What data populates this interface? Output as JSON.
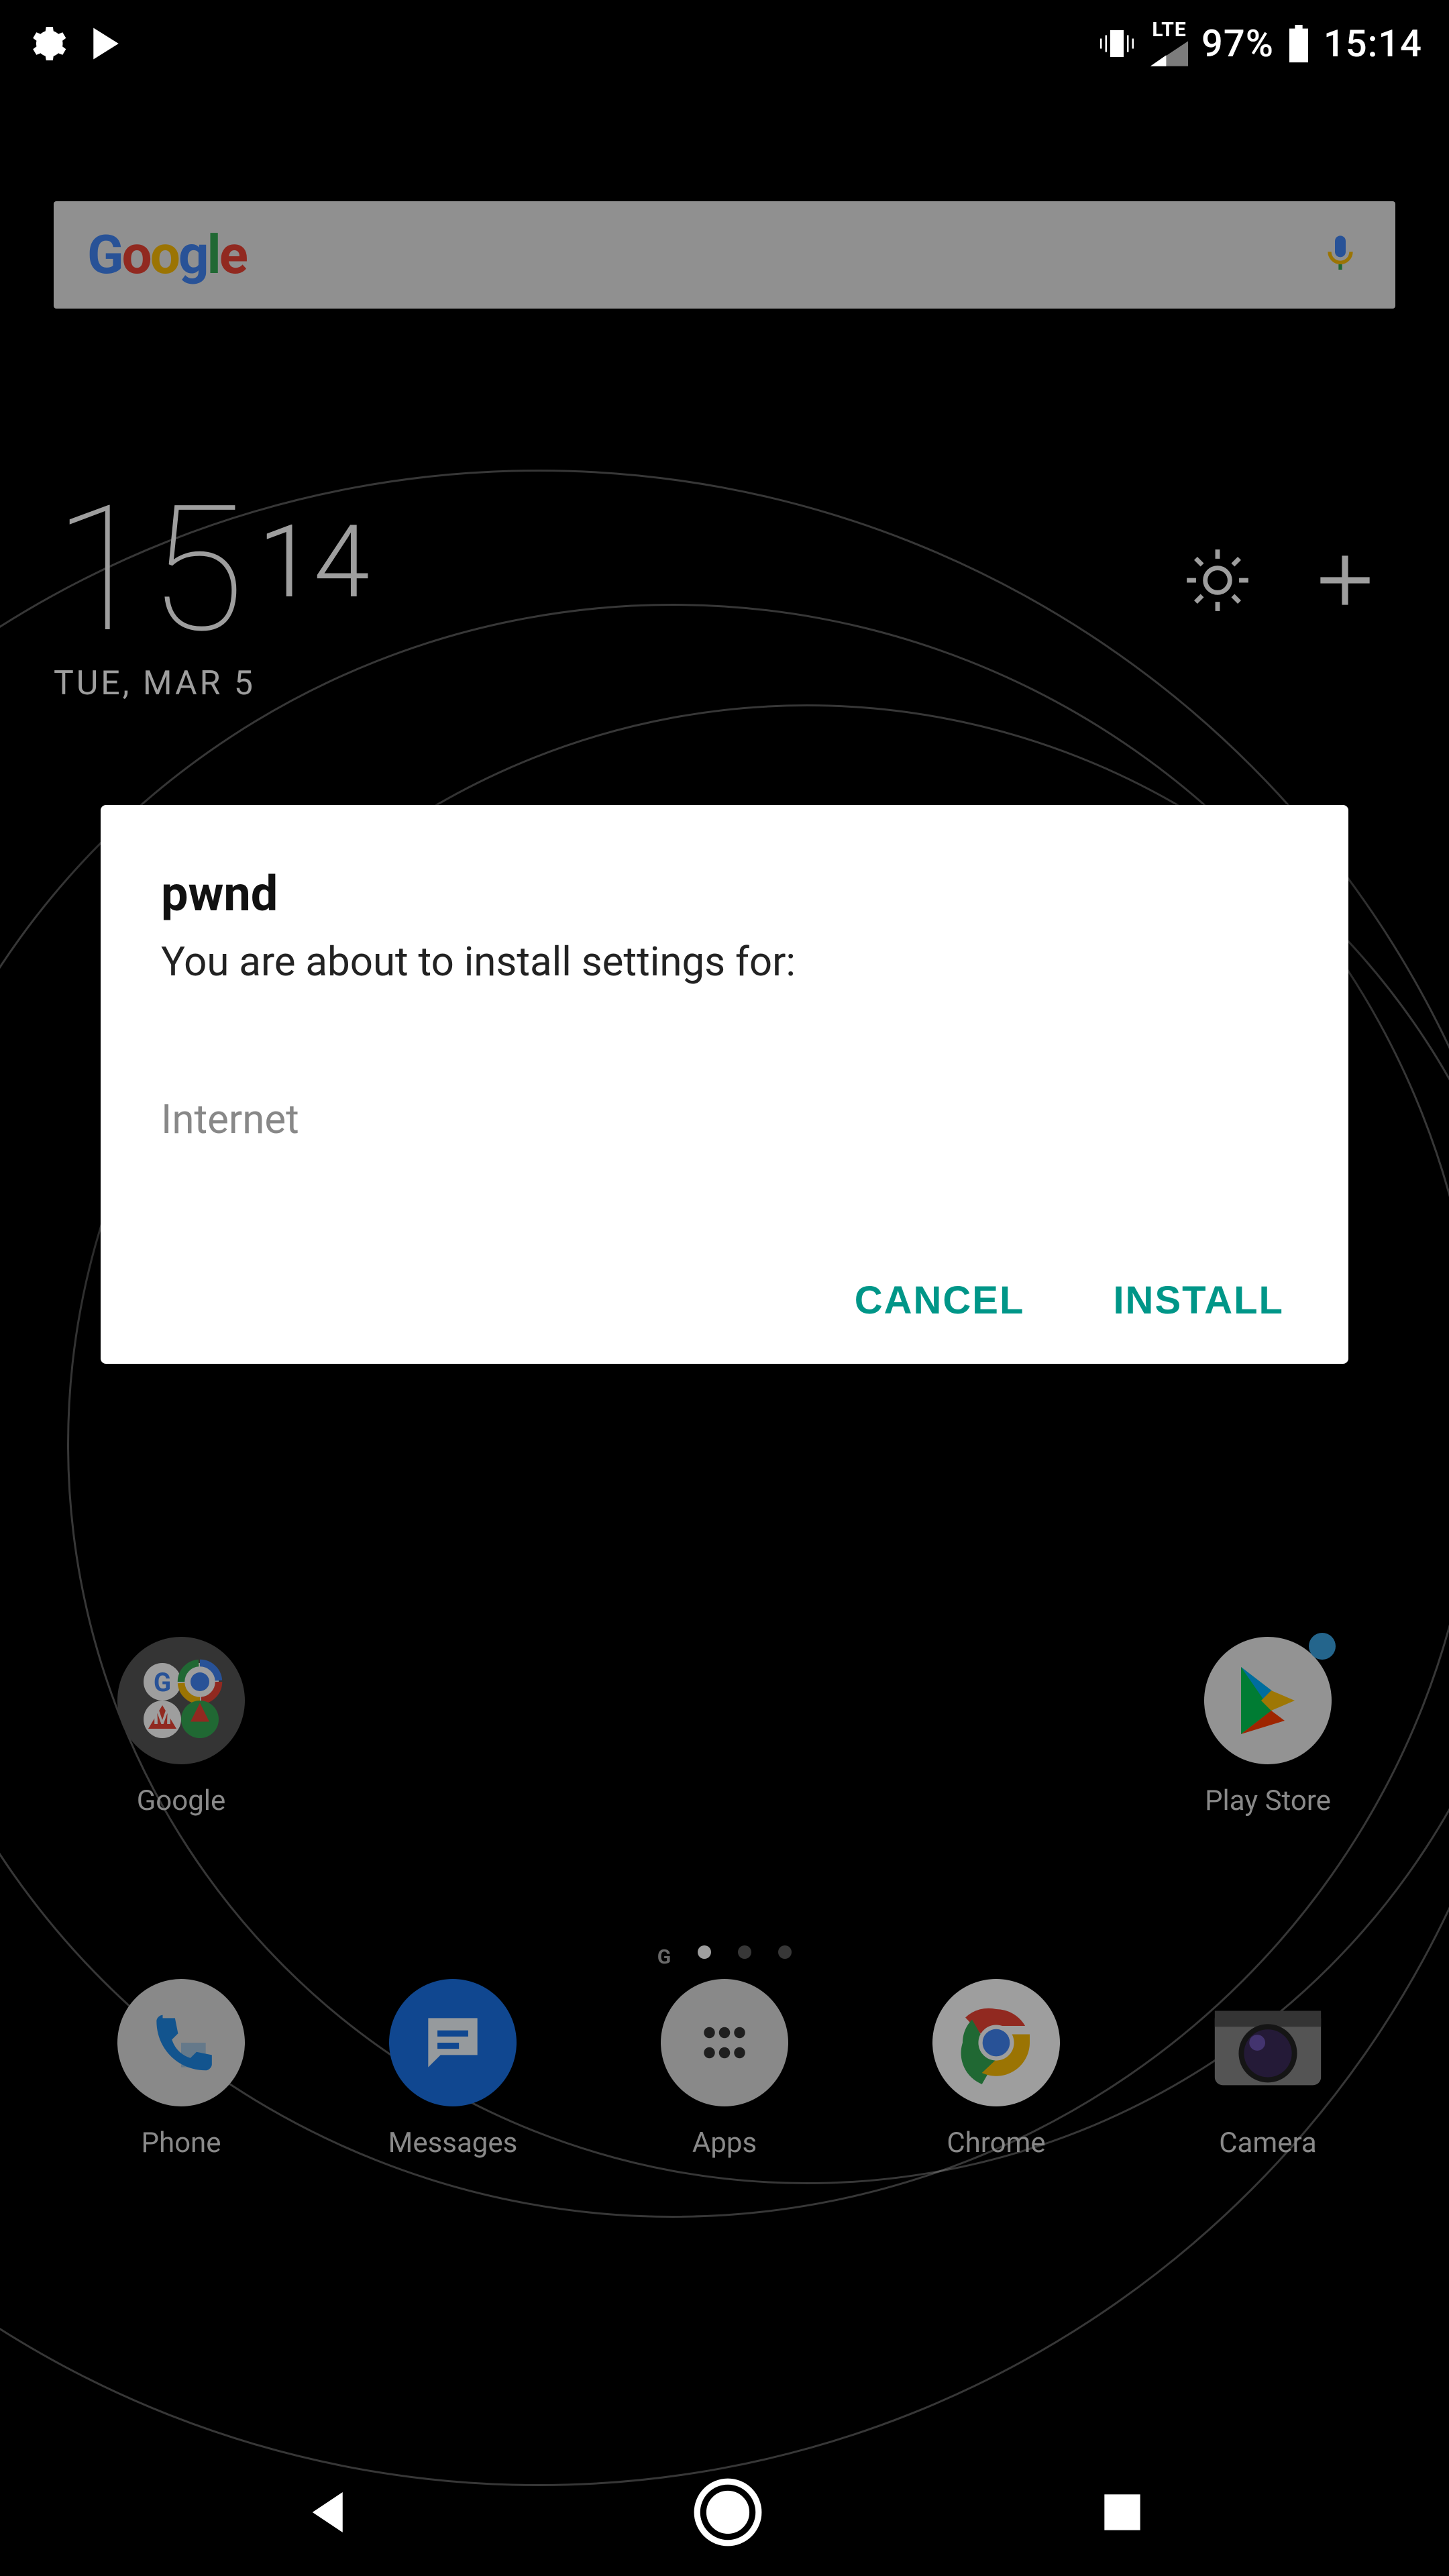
{
  "statusbar": {
    "network_type": "LTE",
    "battery_pct": "97%",
    "clock": "15:14"
  },
  "search": {
    "brand_letters": [
      "G",
      "o",
      "o",
      "g",
      "l",
      "e"
    ]
  },
  "clock_widget": {
    "hours": "15",
    "minutes": "14",
    "date_line": "TUE, MAR 5"
  },
  "dialog": {
    "title": "pwnd",
    "subtitle": "You are about to install settings for:",
    "body": "Internet",
    "cancel_label": "CANCEL",
    "install_label": "INSTALL",
    "accent_color": "#009688"
  },
  "home": {
    "folder_google_label": "Google",
    "play_store_label": "Play Store",
    "dock": [
      {
        "label": "Phone"
      },
      {
        "label": "Messages"
      },
      {
        "label": "Apps"
      },
      {
        "label": "Chrome"
      },
      {
        "label": "Camera"
      }
    ]
  },
  "page_indicator": {
    "glyph": "G",
    "count": 3,
    "active_index": 0
  }
}
